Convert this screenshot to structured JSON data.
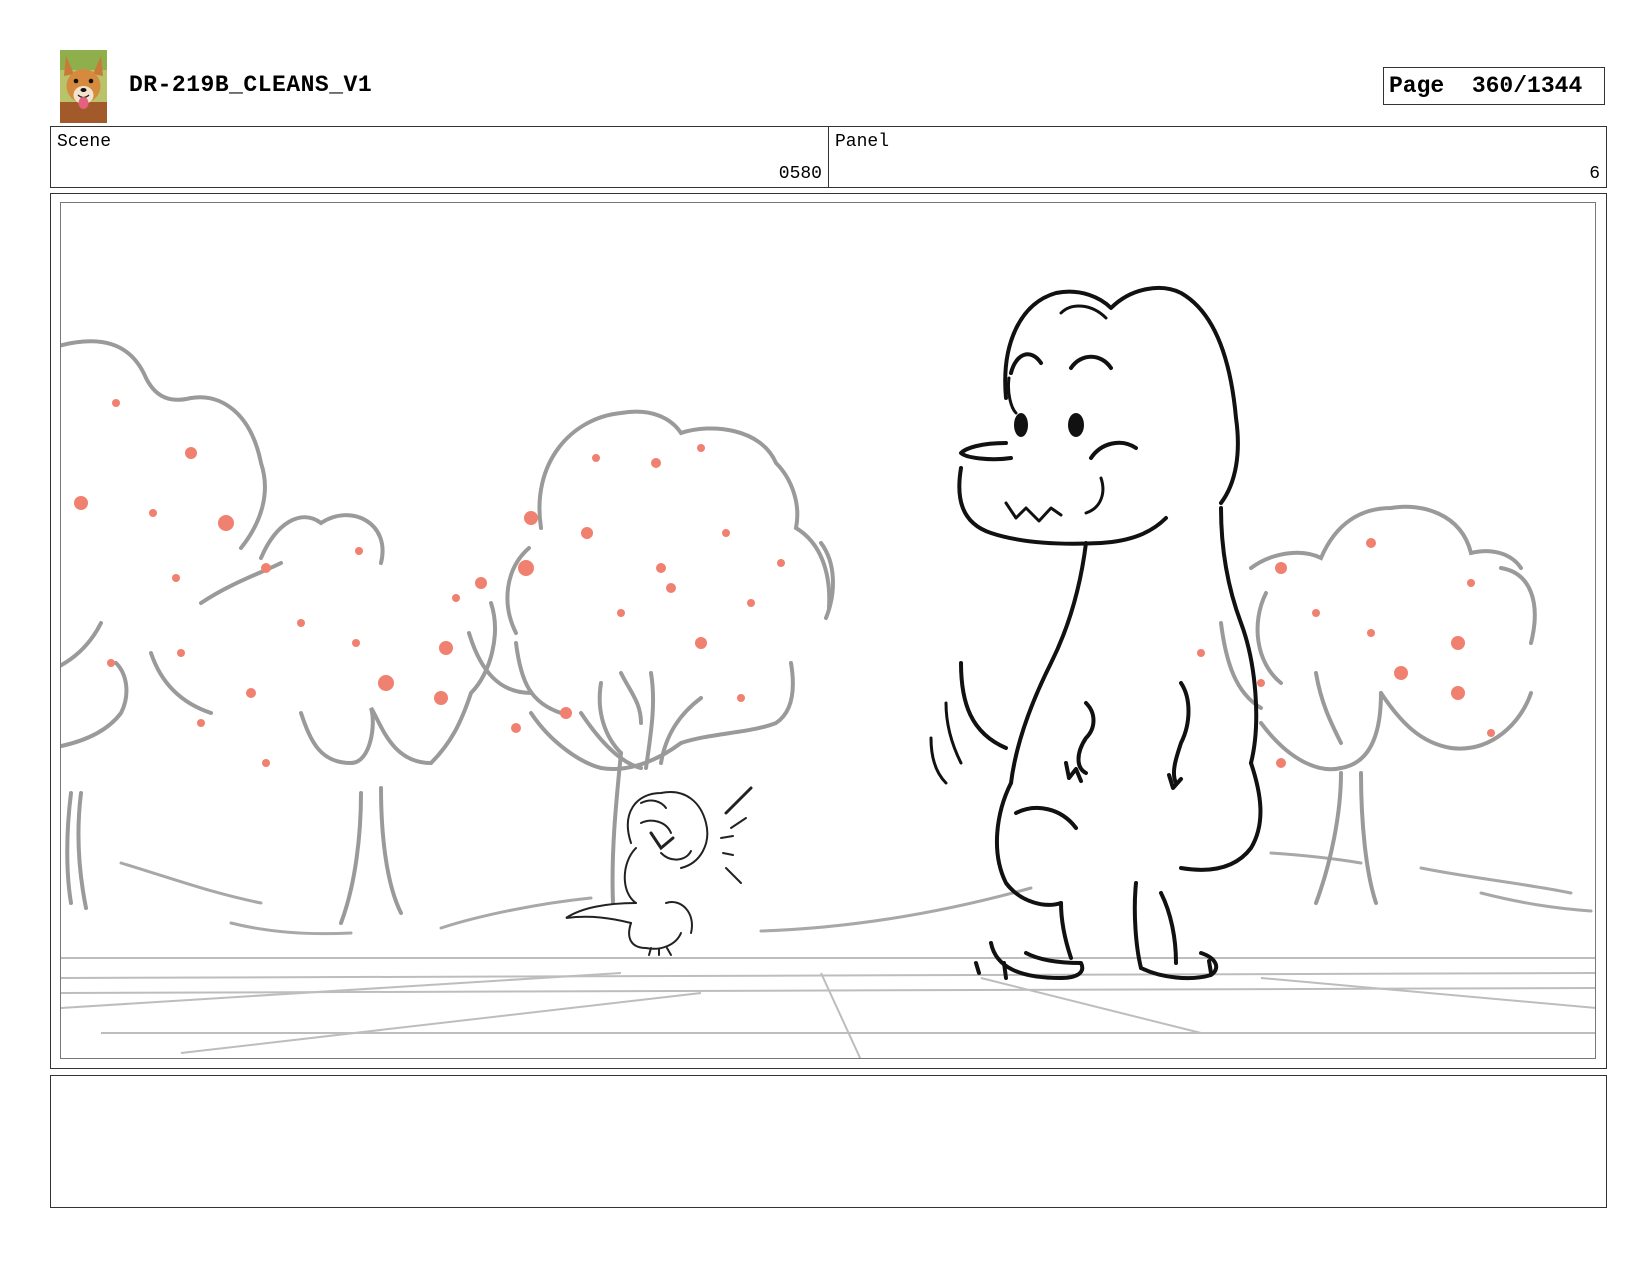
{
  "header": {
    "title": "DR-219B_CLEANS_V1",
    "page_label": "Page",
    "page_number": "360/1344",
    "avatar_icon": "dog-avatar-icon"
  },
  "info": {
    "scene_label": "Scene",
    "scene_value": "0580",
    "panel_label": "Panel",
    "panel_value": "6"
  },
  "notes": {
    "text": ""
  },
  "colors": {
    "border": "#333333",
    "sketch_line": "#111111",
    "tree_line": "#9a9a9a",
    "fruit": "#f08070"
  }
}
